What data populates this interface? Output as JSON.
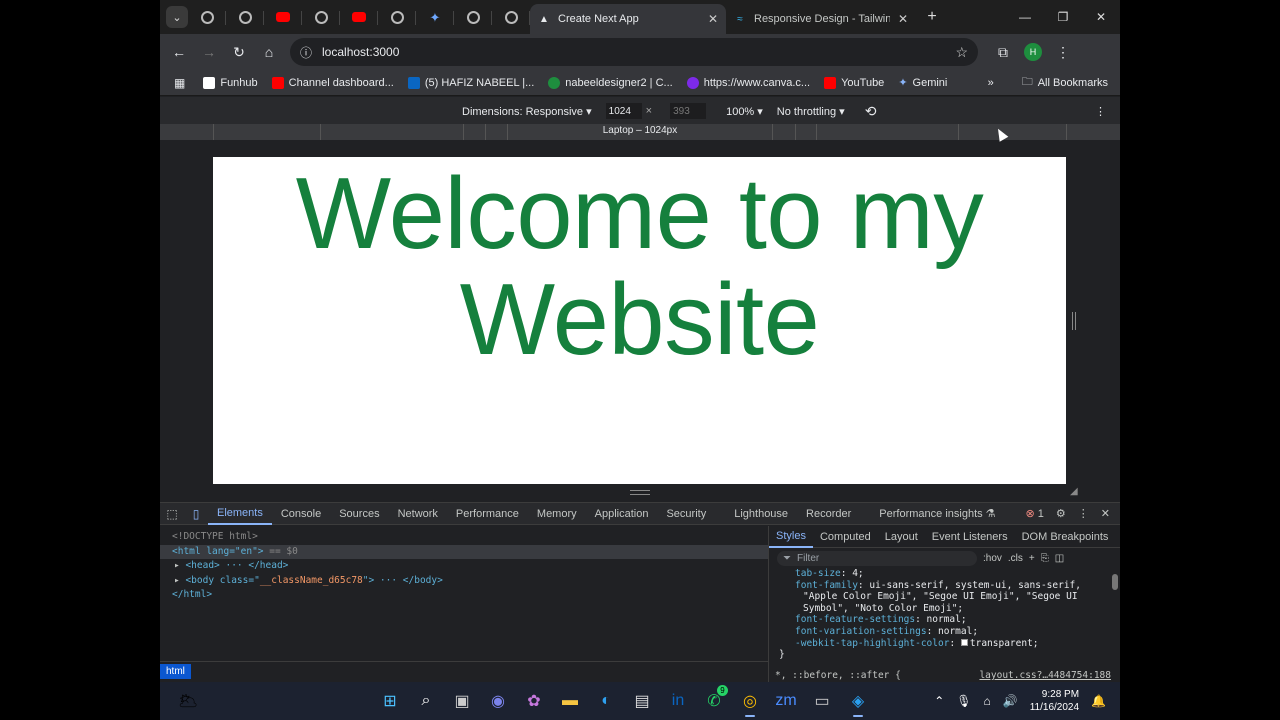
{
  "tabs": {
    "active_title": "Create Next App",
    "inactive_title": "Responsive Design - Tailwind C",
    "new_tab": "+"
  },
  "window_controls": {
    "minimize": "—",
    "maximize": "❐",
    "close": "✕"
  },
  "toolbar": {
    "url": "localhost:3000",
    "profile_initial": "H"
  },
  "bookmarks": {
    "items": [
      {
        "label": "Funhub",
        "color": "#ffffff"
      },
      {
        "label": "Channel dashboard...",
        "color": "#ff0000"
      },
      {
        "label": "(5) HAFIZ NABEEL |...",
        "color": "#0a66c2"
      },
      {
        "label": "nabeeldesigner2 | C...",
        "color": "#1e8e3e"
      },
      {
        "label": "https://www.canva.c...",
        "color": "#7d2ae8"
      },
      {
        "label": "YouTube",
        "color": "#ff0000"
      },
      {
        "label": "Gemini",
        "color": "#8ab4f8"
      }
    ],
    "overflow": "»",
    "all_bookmarks": "All Bookmarks"
  },
  "device_toolbar": {
    "dimensions_label": "Dimensions: Responsive ▾",
    "width": "1024",
    "height": "393",
    "times": "×",
    "zoom": "100% ▾",
    "throttling": "No throttling ▾",
    "ruler_label": "Laptop – 1024px"
  },
  "page": {
    "heading": "Welcome to my Website",
    "heading_color": "#15803d"
  },
  "devtools": {
    "tabs": [
      "Elements",
      "Console",
      "Sources",
      "Network",
      "Performance",
      "Memory",
      "Application",
      "Security",
      "Lighthouse",
      "Recorder",
      "Performance insights ⚗"
    ],
    "error_count": "1",
    "elements": {
      "doctype": "<!DOCTYPE html>",
      "html_open": "<html lang=\"en\">",
      "html_suffix": "== $0",
      "head": "<head> ··· </head>",
      "body_prefix": "<body class=\"",
      "body_class": "__className_d65c78",
      "body_suffix": "\"> ··· </body>",
      "html_close": "</html>"
    },
    "breadcrumb": "html",
    "styles_tabs": [
      "Styles",
      "Computed",
      "Layout",
      "Event Listeners",
      "DOM Breakpoints"
    ],
    "filter_placeholder": "Filter",
    "hov": ":hov",
    "cls": ".cls",
    "css_lines": {
      "l1_prop": "tab-size",
      "l1_val": ": 4;",
      "l2_prop": "font-family",
      "l2_val": ": ui-sans-serif, system-ui, sans-serif,",
      "l3": "\"Apple Color Emoji\", \"Segoe UI Emoji\", \"Segoe UI",
      "l4": "Symbol\", \"Noto Color Emoji\";",
      "l5_prop": "font-feature-settings",
      "l5_val": ": normal;",
      "l6_prop": "font-variation-settings",
      "l6_val": ": normal;",
      "l7_prop": "-webkit-tap-highlight-color",
      "l7_val": "transparent;",
      "l8": "}"
    },
    "css_selector": "*, ::before, ::after {",
    "css_source": "layout.css?…4484754:188"
  },
  "taskbar": {
    "time": "9:28 PM",
    "date": "11/16/2024",
    "badge": "9"
  }
}
